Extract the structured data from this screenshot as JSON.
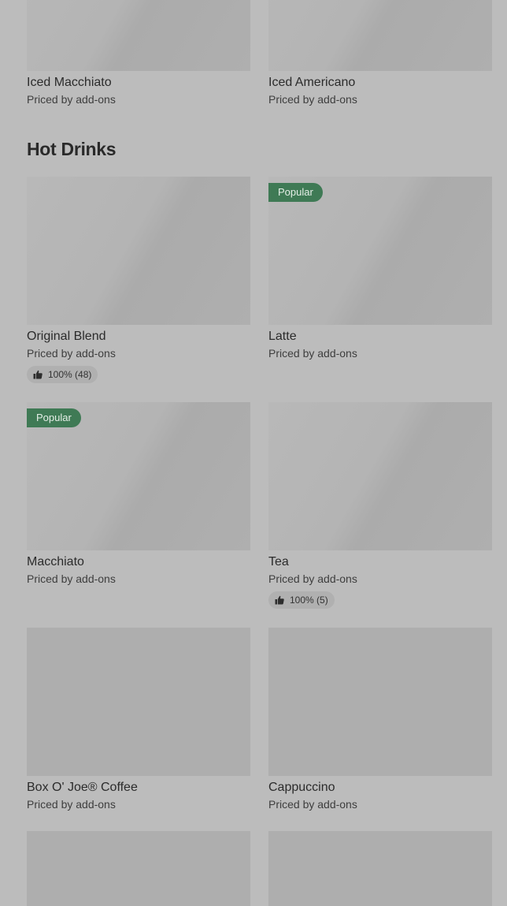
{
  "iced_items": [
    {
      "name": "Iced Macchiato",
      "price": "Priced by add-ons"
    },
    {
      "name": "Iced Americano",
      "price": "Priced by add-ons"
    }
  ],
  "hot_drinks": {
    "title": "Hot Drinks",
    "items": [
      {
        "name": "Original Blend",
        "price": "Priced by add-ons",
        "rating": "100% (48)"
      },
      {
        "name": "Latte",
        "price": "Priced by add-ons",
        "badge": "Popular"
      },
      {
        "name": "Macchiato",
        "price": "Priced by add-ons",
        "badge": "Popular"
      },
      {
        "name": "Tea",
        "price": "Priced by add-ons",
        "rating": "100% (5)"
      },
      {
        "name": "Box O' Joe® Coffee",
        "price": "Priced by add-ons"
      },
      {
        "name": "Cappuccino",
        "price": "Priced by add-ons"
      }
    ]
  },
  "colors": {
    "background": "#bcbcbc",
    "badge": "#3f7a55",
    "rating_pill": "#b0b0b0"
  },
  "icons": {
    "rating": "thumbs-up-icon"
  }
}
